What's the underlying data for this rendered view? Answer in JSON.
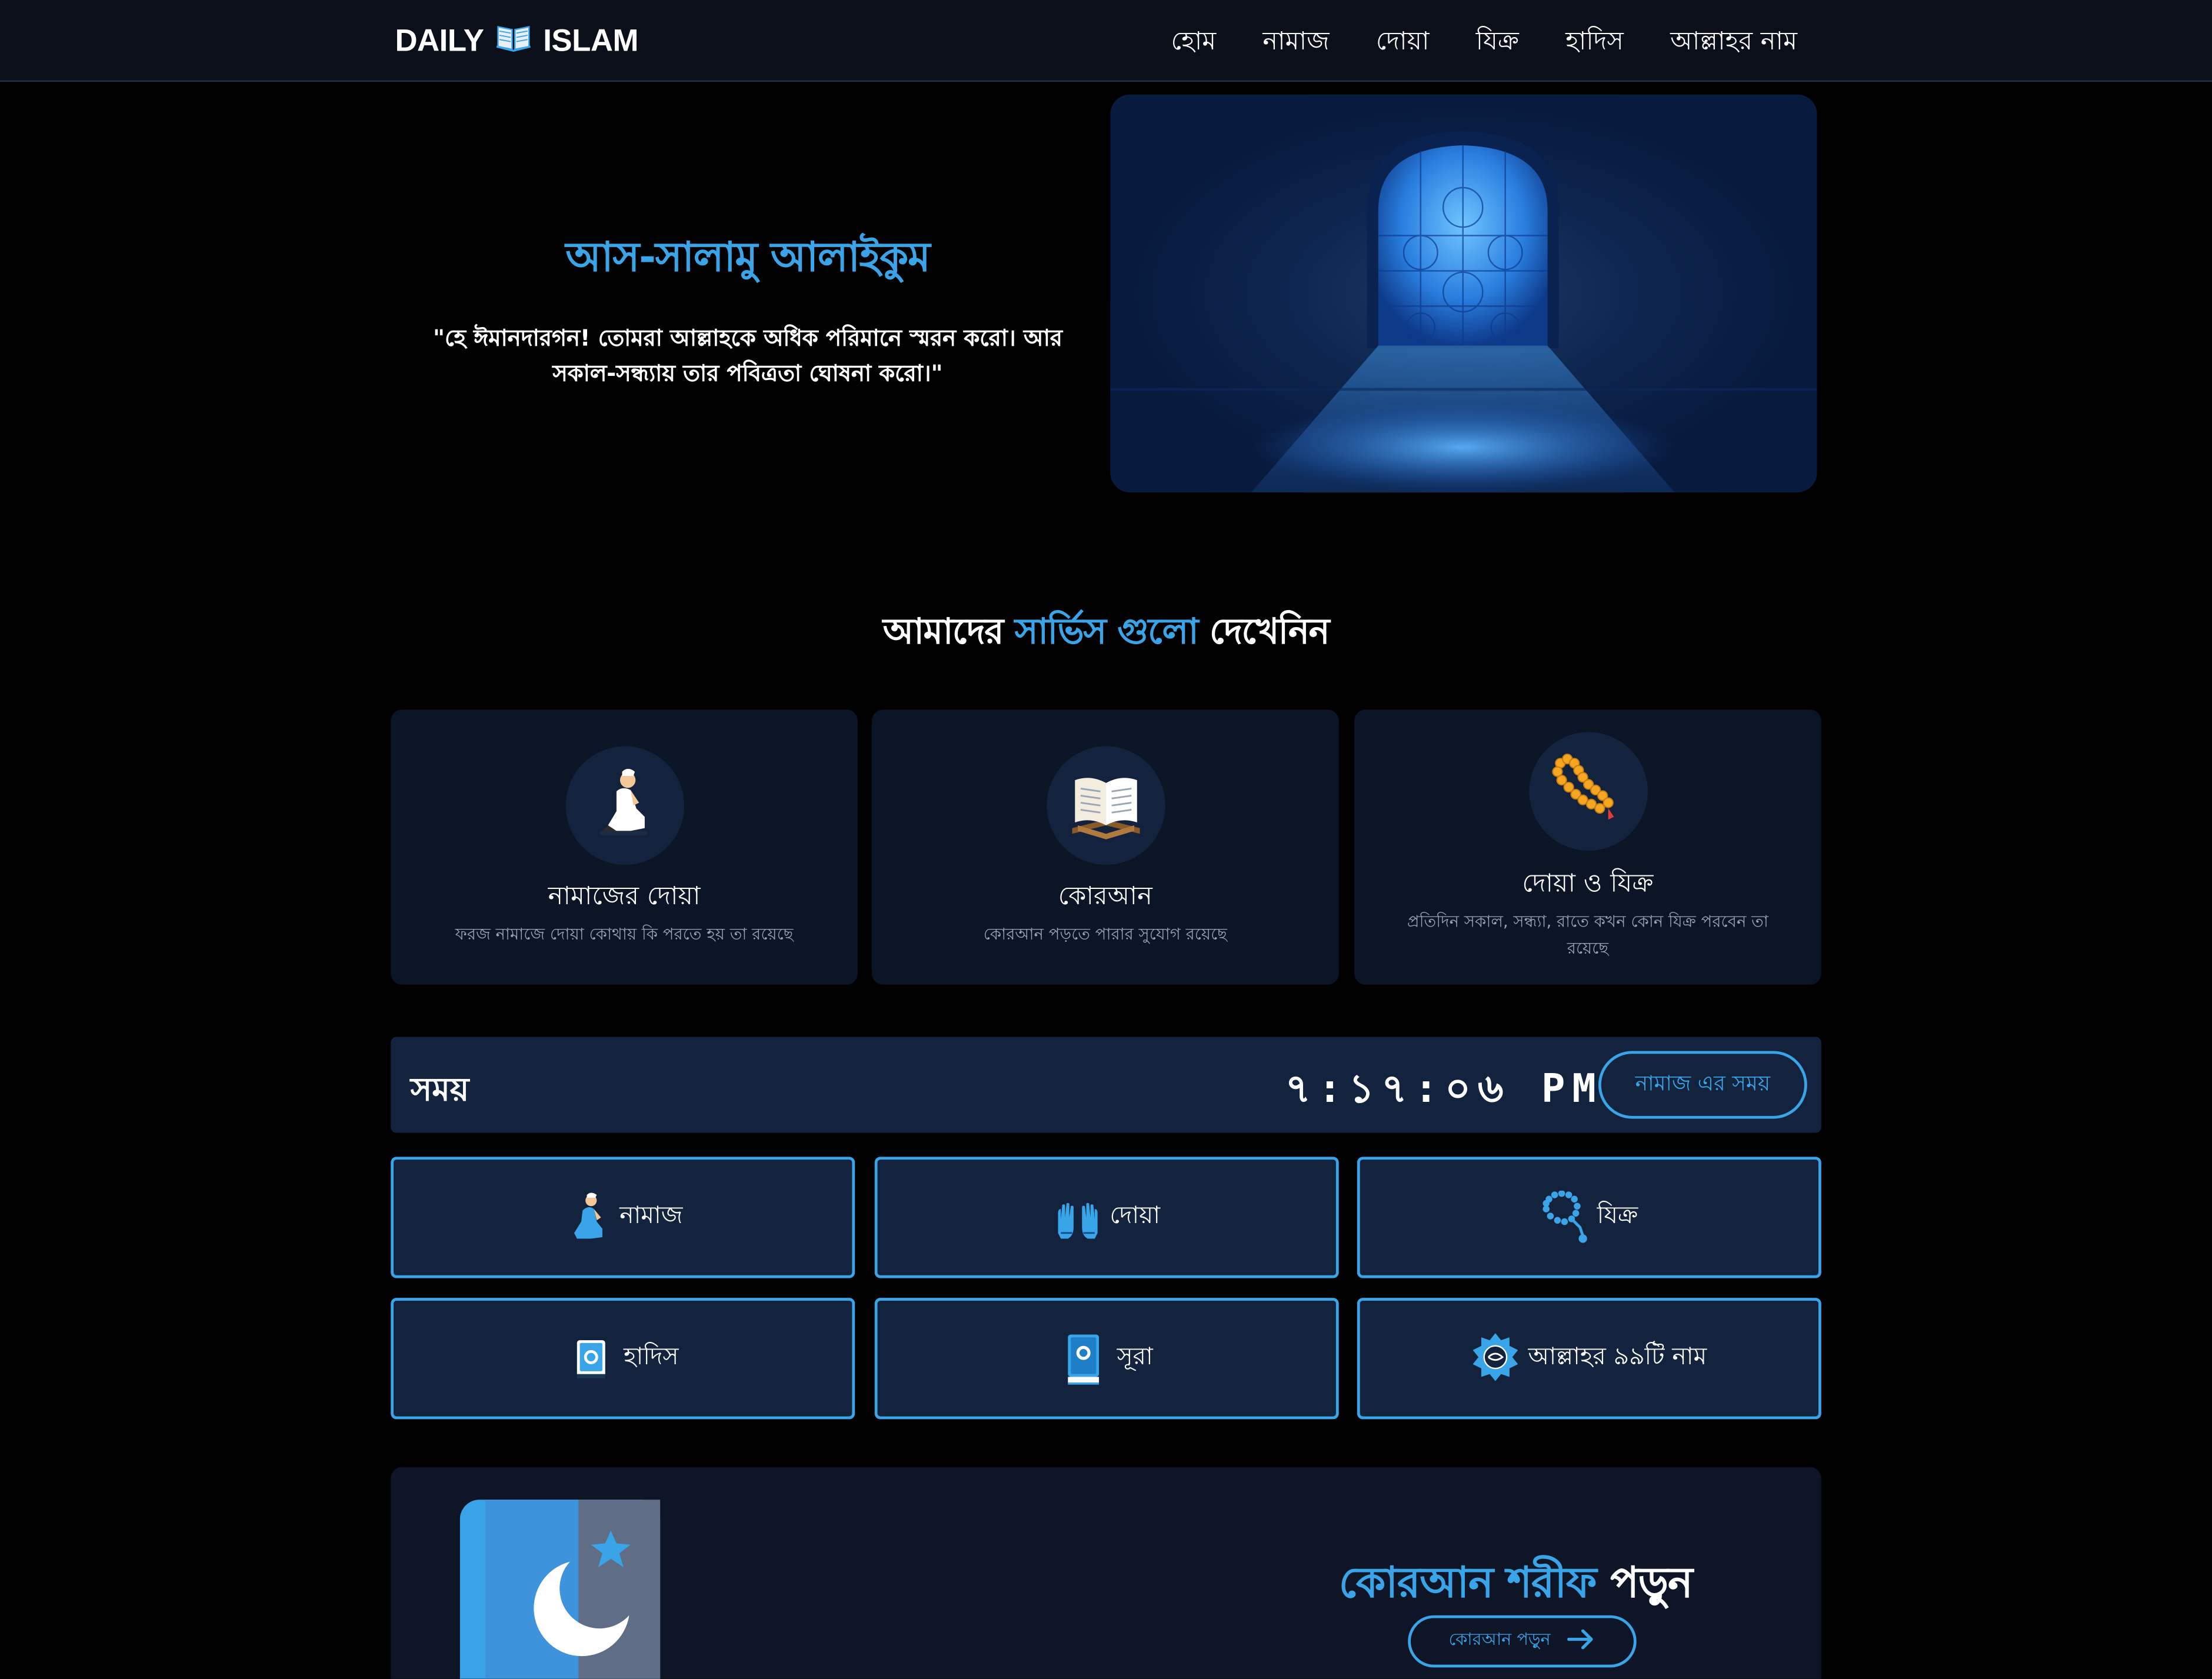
{
  "nav": {
    "brand_left": "DAILY",
    "brand_right": "ISLAM",
    "brand_icon": "open-book-icon",
    "links": [
      "হোম",
      "নামাজ",
      "দোয়া",
      "যিক্র",
      "হাদিস",
      "আল্লাহর নাম"
    ]
  },
  "hero": {
    "greeting": "আস-সালামু আলাইকুম",
    "quote": "\"হে ঈমানদারগন! তোমরা আল্লাহকে অধিক পরিমানে স্মরন করো। আর সকাল-সন্ধ্যায় তার পবিত্রতা ঘোষনা করো।\"",
    "image": "mosque-window-light"
  },
  "services": {
    "heading_start": "আমাদের",
    "heading_accent": "সার্ভিস গুলো",
    "heading_end": "দেখেনিন",
    "cards": [
      {
        "icon": "praying-person-icon",
        "title": "নামাজের দোয়া",
        "desc": "ফরজ নামাজে দোয়া কোথায় কি পরতে হয় তা রয়েছে"
      },
      {
        "icon": "quran-book-icon",
        "title": "কোরআন",
        "desc": "কোরআন পড়তে পারার সুযোগ রয়েছে"
      },
      {
        "icon": "prayer-beads-icon",
        "title": "দোয়া ও যিক্র",
        "desc": "প্রতিদিন সকাল, সন্ধ্যা, রাতে কখন কোন যিক্র পরবেন তা রয়েছে"
      }
    ]
  },
  "time_bar": {
    "label": "সময়",
    "clock": "৭:১৭:০৬ PM",
    "button": "নামাজ এর সময়"
  },
  "quick_links": [
    {
      "icon": "praying-person-icon",
      "label": "নামাজ"
    },
    {
      "icon": "raised-hands-icon",
      "label": "দোয়া"
    },
    {
      "icon": "tasbih-beads-icon",
      "label": "যিক্র"
    },
    {
      "icon": "hadith-book-icon",
      "label": "হাদিস"
    },
    {
      "icon": "surah-book-icon",
      "label": "সূরা"
    },
    {
      "icon": "allah-names-emblem-icon",
      "label": "আল্লাহর ৯৯টি নাম"
    }
  ],
  "quran_banner": {
    "title_accent": "কোরআন শরীফ",
    "title_end": "পড়ুন",
    "button": "কোরআন পড়ুন",
    "button_icon": "arrow-right-icon",
    "graphic": "moon-star-book-icon"
  },
  "colors": {
    "accent": "#3aa4e8",
    "navbar": "#0b0f1a",
    "card": "#0c1526",
    "panel": "#13233d"
  }
}
